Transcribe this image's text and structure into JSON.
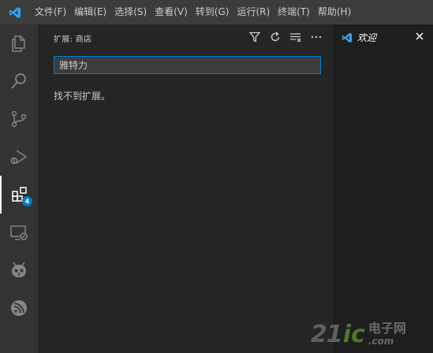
{
  "menu": [
    "文件(F)",
    "编辑(E)",
    "选择(S)",
    "查看(V)",
    "转到(G)",
    "运行(R)",
    "终端(T)",
    "帮助(H)"
  ],
  "activitybar": {
    "items": [
      {
        "name": "explorer-icon"
      },
      {
        "name": "search-icon"
      },
      {
        "name": "source-control-icon"
      },
      {
        "name": "run-debug-icon"
      },
      {
        "name": "extensions-icon",
        "active": true,
        "badge": "4"
      },
      {
        "name": "remote-explorer-icon"
      },
      {
        "name": "platformio-icon"
      },
      {
        "name": "espressif-icon"
      }
    ]
  },
  "sidebar": {
    "title": "扩展: 商店",
    "actions": [
      "filter-icon",
      "refresh-icon",
      "clear-list-icon",
      "more-icon"
    ],
    "search_value": "雅特力",
    "empty_message": "找不到扩展。"
  },
  "editor": {
    "tab_label": "欢迎"
  },
  "watermark": {
    "num": "21",
    "ic": "ic",
    "cn": "电子网",
    "com": ".com"
  },
  "colors": {
    "accent": "#007acc",
    "titlebar": "#3c3c3c",
    "activitybar": "#333333",
    "sidebar": "#252526",
    "editor": "#1e1e1e"
  }
}
